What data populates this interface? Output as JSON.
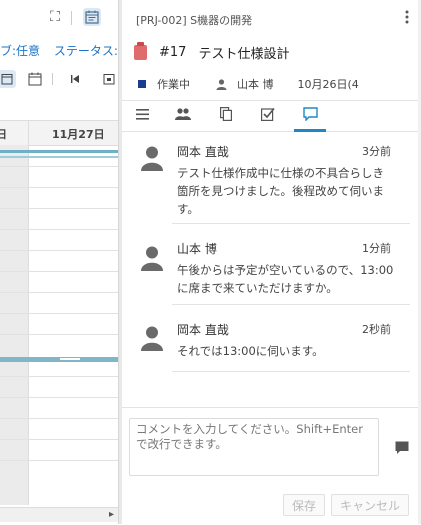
{
  "gantt": {
    "filters": [
      "ブ:任意",
      "ステータス:任"
    ],
    "date_prev": "日",
    "date_current": "11月27日",
    "scroll_right": "▸"
  },
  "task": {
    "project": "[PRJ-002] S機器の開発",
    "number": "#17",
    "title": "テスト仕様設計",
    "status": "作業中",
    "status_color": "#1a3d8f",
    "assignee": "山本 博",
    "date": "10月26日(4"
  },
  "tabs": [
    "list-icon",
    "people-icon",
    "copy-icon",
    "checklist-icon",
    "comment-icon"
  ],
  "comments": [
    {
      "author": "岡本 直哉",
      "time": "3分前",
      "text": "テスト仕様作成中に仕様の不具合らしき箇所を見つけました。後程改めて伺います。"
    },
    {
      "author": "山本 博",
      "time": "1分前",
      "text": "午後からは予定が空いているので、13:00に席まで来ていただけますか。"
    },
    {
      "author": "岡本 直哉",
      "time": "2秒前",
      "text": "それでは13:00に伺います。"
    }
  ],
  "compose": {
    "placeholder": "コメントを入力してください。Shift+Enterで改行できます。",
    "save_label": "保存",
    "cancel_label": "キャンセル"
  }
}
